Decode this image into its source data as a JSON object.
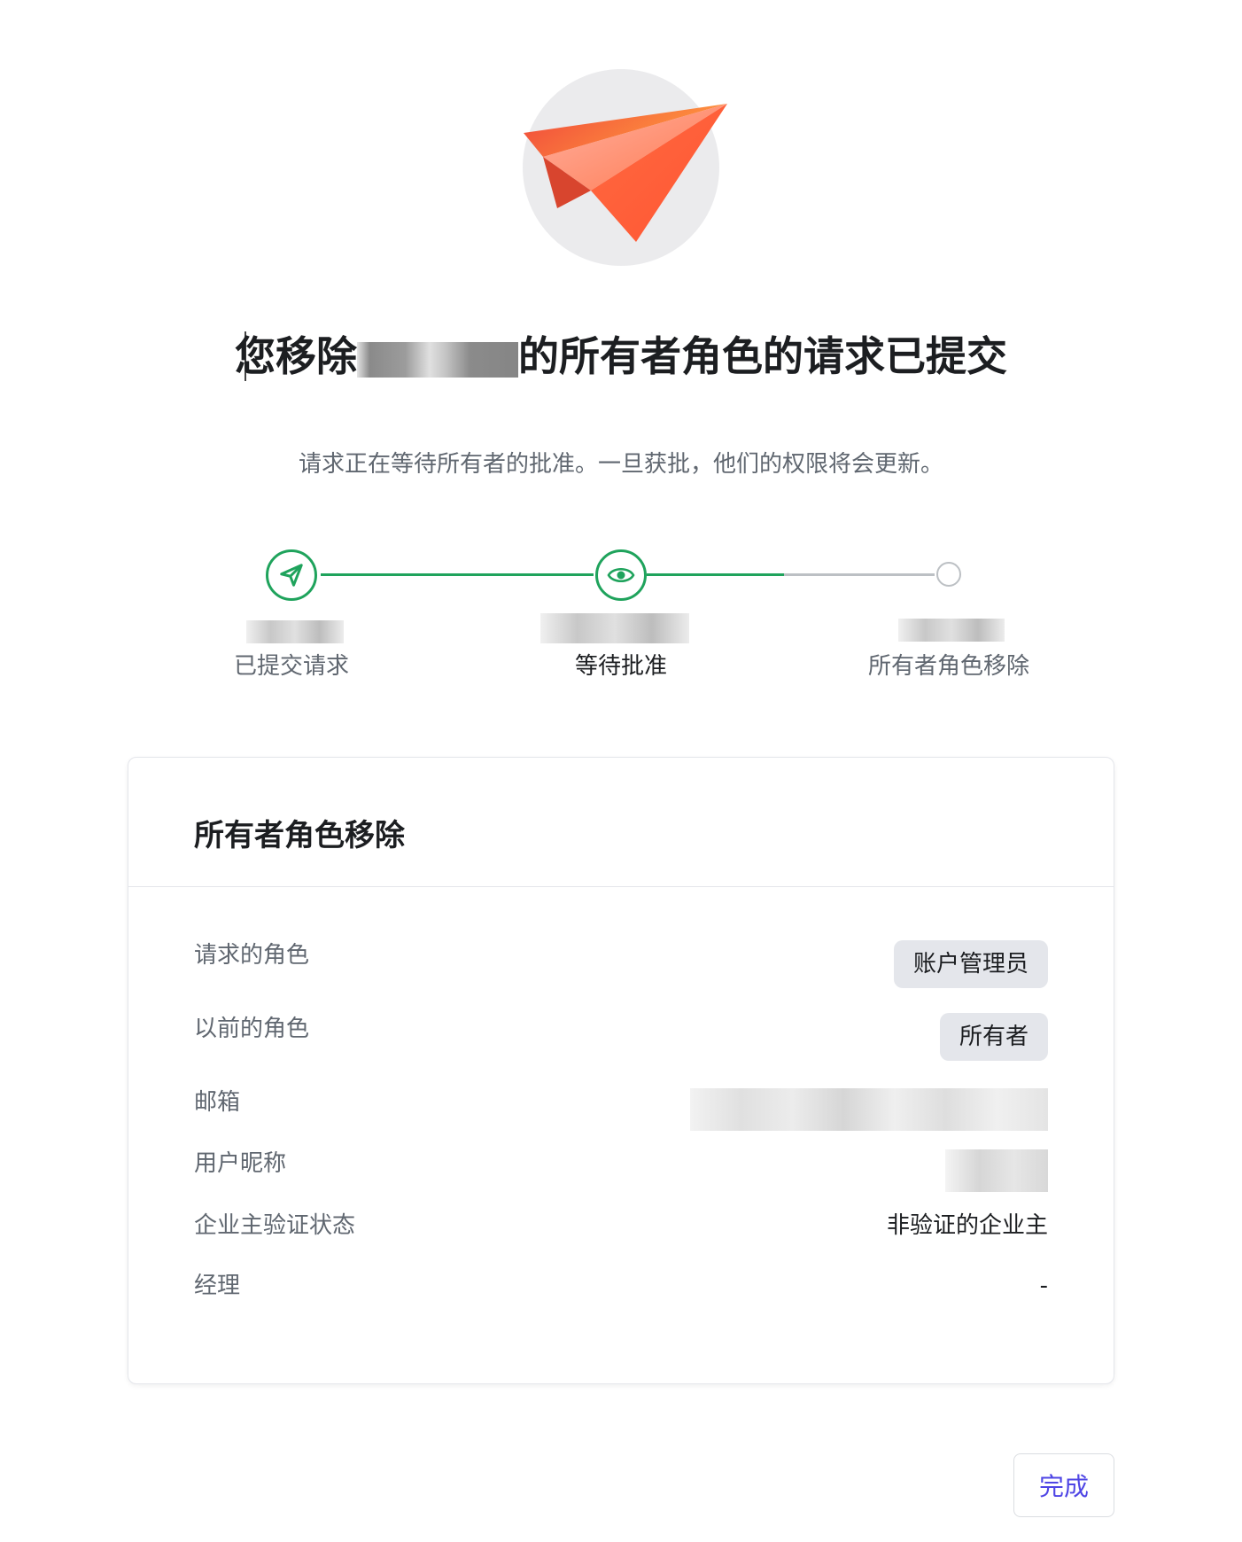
{
  "title": {
    "prefix": "您移除",
    "suffix": "的所有者角色的请求已提交"
  },
  "subtitle": "请求正在等待所有者的批准。一旦获批，他们的权限将会更新。",
  "steps": [
    {
      "label": "已提交请求",
      "icon": "paper-plane-icon",
      "state": "complete"
    },
    {
      "label": "等待批准",
      "icon": "eye-icon",
      "state": "current"
    },
    {
      "label": "所有者角色移除",
      "icon": "empty-circle",
      "state": "pending"
    }
  ],
  "card": {
    "title": "所有者角色移除",
    "rows": [
      {
        "label": "请求的角色",
        "value": "账户管理员",
        "kind": "pill"
      },
      {
        "label": "以前的角色",
        "value": "所有者",
        "kind": "pill"
      },
      {
        "label": "邮箱",
        "value": "",
        "kind": "redacted"
      },
      {
        "label": "用户昵称",
        "value": "",
        "kind": "redacted"
      },
      {
        "label": "企业主验证状态",
        "value": "非验证的企业主",
        "kind": "text"
      },
      {
        "label": "经理",
        "value": "-",
        "kind": "text"
      }
    ]
  },
  "done_button": "完成",
  "colors": {
    "accent_green": "#1fa35c",
    "pending_gray": "#bcc0c4",
    "link_purple": "#4f46e5",
    "plane_red": "#f0463c",
    "plane_orange": "#ff8a3d"
  }
}
